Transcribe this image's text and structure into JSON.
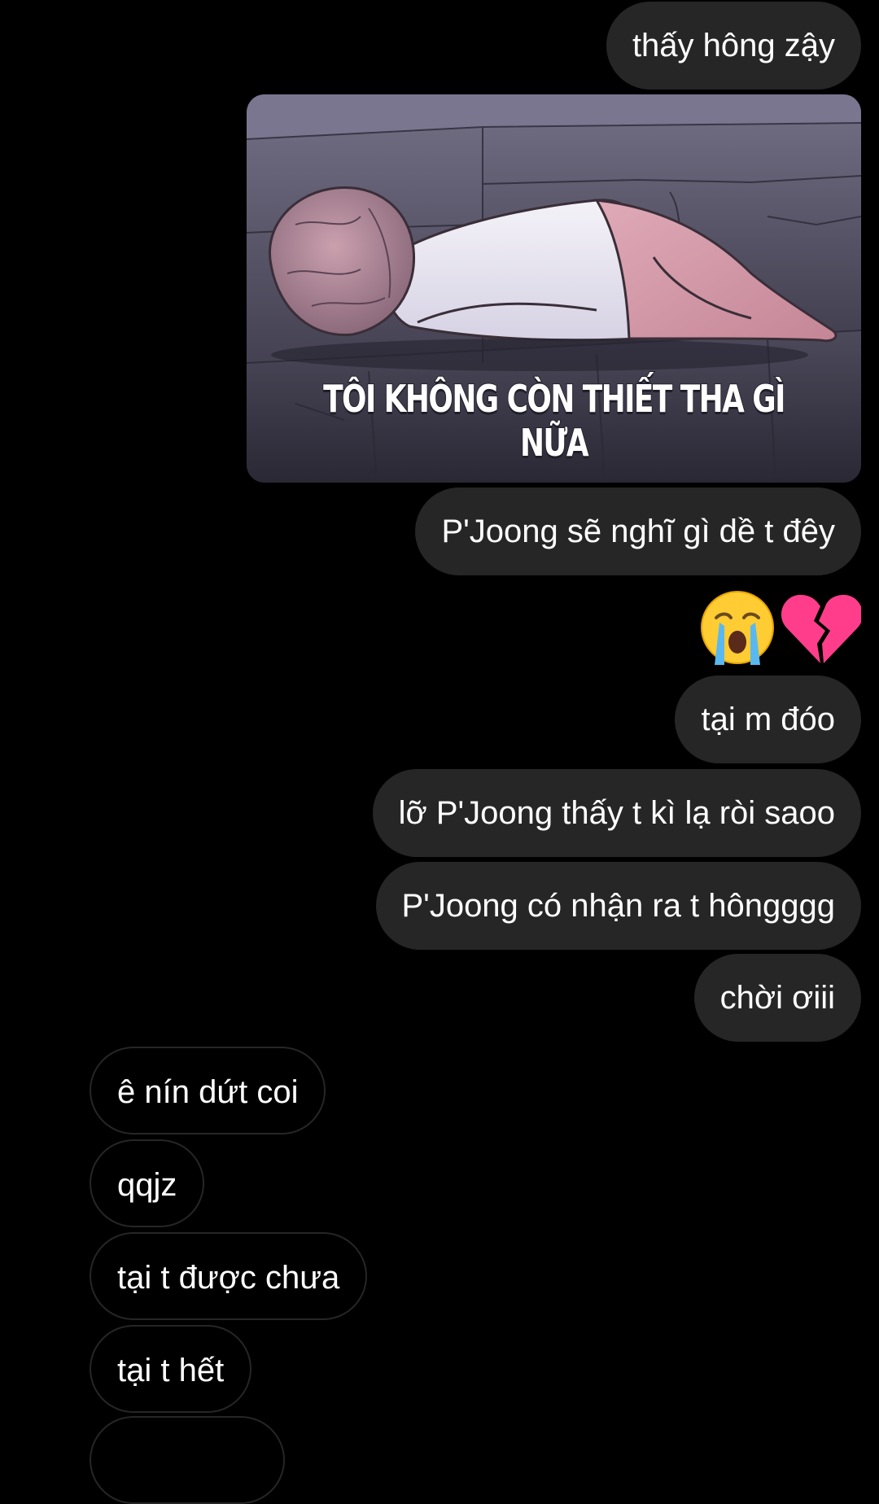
{
  "messages": {
    "sent_1": "thấy hông zậy",
    "sticker_caption": "TÔI KHÔNG CÒN THIẾT THA GÌ NỮA",
    "sent_2": "P'Joong sẽ nghĩ gì dề t đêy",
    "reaction_emojis": [
      "crying-face",
      "broken-heart"
    ],
    "sent_3": "tại m đóo",
    "sent_4": "lỡ P'Joong thấy t kì lạ ròi saoo",
    "sent_5": "P'Joong có nhận ra t hôngggg",
    "sent_6": "chời ơiii",
    "recv_1": "ê nín dứt coi",
    "recv_2": "qqjz",
    "recv_3": "tại t được chưa",
    "recv_4": "tại t hết"
  },
  "colors": {
    "background": "#000000",
    "sent_bubble": "#262626",
    "received_border": "#262626",
    "text": "#ffffff"
  }
}
